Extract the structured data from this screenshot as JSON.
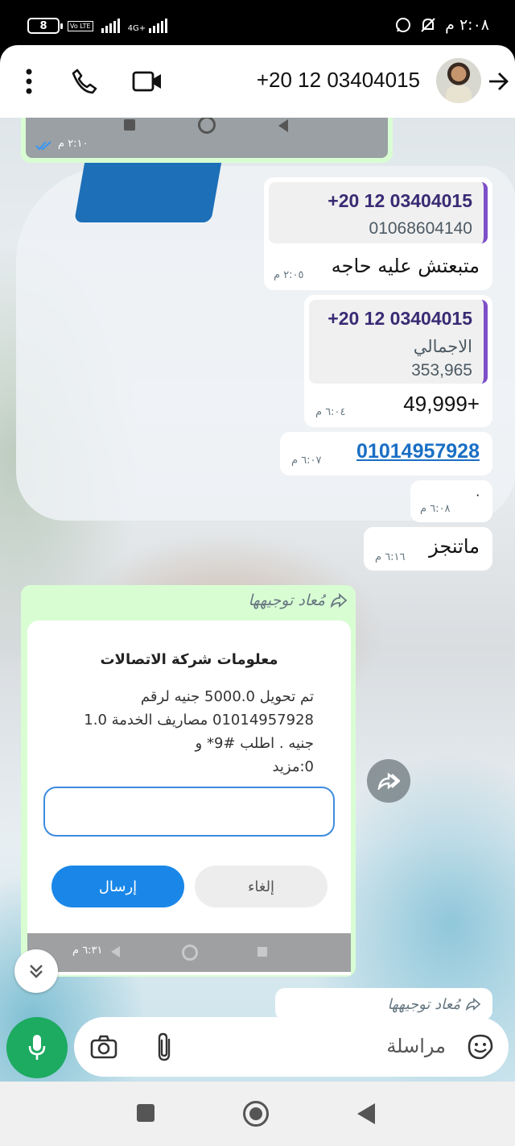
{
  "status_bar": {
    "battery": "8",
    "network": "4G+",
    "volte": "Vo LTE",
    "time": "٢:٠٨ م"
  },
  "header": {
    "contact_name": "+20 12 03404015",
    "back_icon": "arrow-right-icon",
    "video_icon": "video-camera-icon",
    "call_icon": "phone-icon",
    "menu_icon": "more-vert-icon"
  },
  "messages": {
    "m0": {
      "time": "٢:١٠ م"
    },
    "m1": {
      "quote_name": "+20 12 03404015",
      "quote_text": "01068604140",
      "text": "متبعتش عليه حاجه",
      "time": "٢:٠٥ م"
    },
    "m2": {
      "quote_name": "+20 12 03404015",
      "quote_line1": "الاجمالي",
      "quote_line2": "353,965",
      "text": "49,999+",
      "time": "٦:٠٤ م"
    },
    "m3": {
      "text": "01014957928",
      "time": "٦:٠٧ م"
    },
    "m4": {
      "text": "٠",
      "time": "٦:٠٨ م"
    },
    "m5": {
      "text": "ماتنجز",
      "time": "٦:١٦ م"
    },
    "m6": {
      "forwarded_label": "مُعاد توجيهها",
      "dialog_title": "معلومات شركة الاتصالات",
      "dialog_line1": "تم تحويل 5000.0 جنيه لرقم",
      "dialog_line2": "01014957928 مصاريف الخدمة 1.0",
      "dialog_line3": "جنيه . اطلب #9* و",
      "dialog_line4": "0:مزيد",
      "send_button": "إرسال",
      "cancel_button": "إلغاء",
      "time": "٦:٣١ م"
    },
    "m7": {
      "forwarded_label": "مُعاد توجيهها"
    }
  },
  "composer": {
    "placeholder": "مراسلة"
  },
  "colors": {
    "outgoing_bubble": "#d9fdd3",
    "incoming_bubble": "#ffffff",
    "accent_green": "#1daa61",
    "link_blue": "#1a6fc4",
    "quote_bar": "#7d4fc8"
  }
}
